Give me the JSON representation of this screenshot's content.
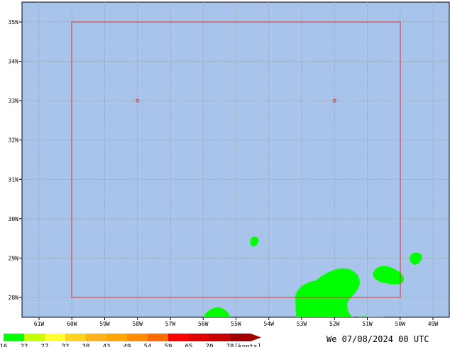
{
  "map": {
    "background_color": "#a9c4ea",
    "grid_color": "#9a9a9a",
    "box_color": "#e03030",
    "wind_color": "#00ff00",
    "lat_labels": [
      "35N",
      "34N",
      "33N",
      "32N",
      "31N",
      "30N",
      "29N",
      "28N"
    ],
    "lon_labels": [
      "61W",
      "60W",
      "59W",
      "58W",
      "57W",
      "56W",
      "55W",
      "54W",
      "53W",
      "52W",
      "51W",
      "50W",
      "49W"
    ],
    "markers": [
      {
        "name": "point-58w-33n",
        "lon": -58,
        "lat": 33
      },
      {
        "name": "point-52w-33n",
        "lon": -52,
        "lat": 33
      }
    ]
  },
  "colorbar": {
    "segments": [
      {
        "label": "16",
        "color": "#00ff00"
      },
      {
        "label": "22",
        "color": "#c8ff00"
      },
      {
        "label": "27",
        "color": "#ffff33"
      },
      {
        "label": "32",
        "color": "#ffd21f"
      },
      {
        "label": "38",
        "color": "#ffb21f"
      },
      {
        "label": "43",
        "color": "#ffa500"
      },
      {
        "label": "49",
        "color": "#ff8c00"
      },
      {
        "label": "54",
        "color": "#ff6a00"
      },
      {
        "label": "59",
        "color": "#ff0000"
      },
      {
        "label": "65",
        "color": "#e00000"
      },
      {
        "label": "70",
        "color": "#c80000"
      },
      {
        "label": "78",
        "color": "#a00000"
      }
    ],
    "unit": "[knots]"
  },
  "timestamp": "We 07/08/2024 00 UTC"
}
